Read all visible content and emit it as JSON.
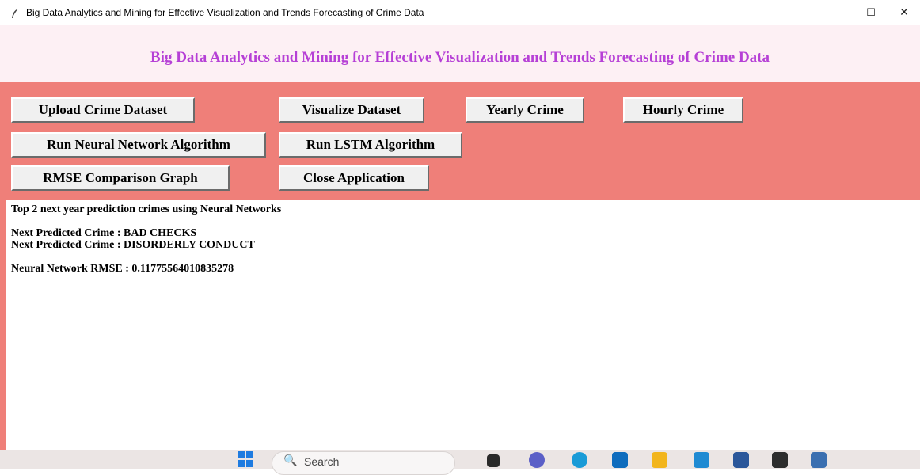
{
  "window": {
    "title": "Big Data Analytics and Mining for Effective Visualization and Trends Forecasting of Crime Data",
    "minimize_glyph": "—",
    "maximize_glyph": "☐",
    "close_glyph": "✕"
  },
  "header": {
    "title": "Big Data Analytics and Mining for Effective Visualization and Trends Forecasting of Crime Data",
    "title_color": "#b640d6",
    "background": "#fdf0f4"
  },
  "panel": {
    "background": "#ef7f79"
  },
  "buttons": {
    "upload": "Upload Crime Dataset",
    "visualize": "Visualize Dataset",
    "yearly": "Yearly Crime",
    "hourly": "Hourly Crime",
    "neural": "Run Neural Network Algorithm",
    "lstm": "Run LSTM Algorithm",
    "rmse": "RMSE Comparison Graph",
    "close": "Close Application"
  },
  "output": {
    "line1": "Top 2 next year prediction crimes using Neural Networks",
    "line2": "Next Predicted Crime : BAD CHECKS",
    "line3": "Next Predicted Crime : DISORDERLY CONDUCT",
    "line4": "Neural Network RMSE : 0.11775564010835278"
  },
  "taskbar": {
    "search_placeholder": "Search",
    "search_icon_glyph": "🔍",
    "icons": [
      "windows-start-icon",
      "file-explorer-icon",
      "teams-chat-icon",
      "edge-browser-icon",
      "mail-icon",
      "folder-icon",
      "vscode-icon",
      "word-icon",
      "terminal-icon",
      "python-app-icon"
    ]
  }
}
